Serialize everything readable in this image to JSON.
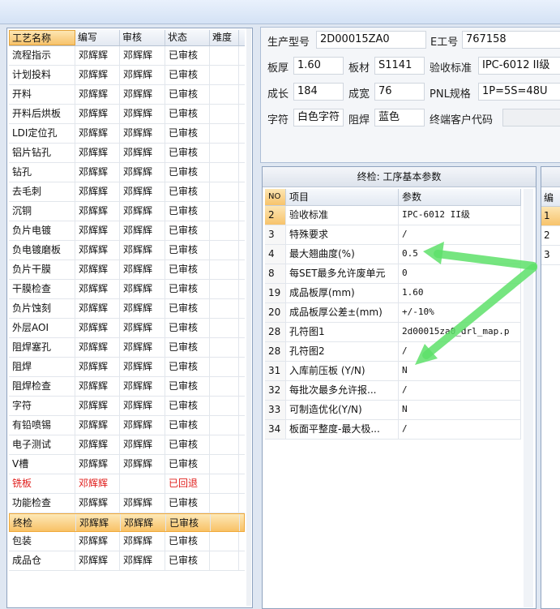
{
  "process_table": {
    "headers": [
      "工艺名称",
      "编写",
      "审核",
      "状态",
      "难度"
    ],
    "rows": [
      {
        "name": "流程指示",
        "writer": "邓辉辉",
        "reviewer": "邓辉辉",
        "status": "已审核",
        "difficulty": ""
      },
      {
        "name": "计划投料",
        "writer": "邓辉辉",
        "reviewer": "邓辉辉",
        "status": "已审核",
        "difficulty": ""
      },
      {
        "name": "开料",
        "writer": "邓辉辉",
        "reviewer": "邓辉辉",
        "status": "已审核",
        "difficulty": ""
      },
      {
        "name": "开料后烘板",
        "writer": "邓辉辉",
        "reviewer": "邓辉辉",
        "status": "已审核",
        "difficulty": ""
      },
      {
        "name": "LDI定位孔",
        "writer": "邓辉辉",
        "reviewer": "邓辉辉",
        "status": "已审核",
        "difficulty": ""
      },
      {
        "name": "铝片钻孔",
        "writer": "邓辉辉",
        "reviewer": "邓辉辉",
        "status": "已审核",
        "difficulty": ""
      },
      {
        "name": "钻孔",
        "writer": "邓辉辉",
        "reviewer": "邓辉辉",
        "status": "已审核",
        "difficulty": ""
      },
      {
        "name": "去毛刺",
        "writer": "邓辉辉",
        "reviewer": "邓辉辉",
        "status": "已审核",
        "difficulty": ""
      },
      {
        "name": "沉铜",
        "writer": "邓辉辉",
        "reviewer": "邓辉辉",
        "status": "已审核",
        "difficulty": ""
      },
      {
        "name": "负片电镀",
        "writer": "邓辉辉",
        "reviewer": "邓辉辉",
        "status": "已审核",
        "difficulty": ""
      },
      {
        "name": "负电镀磨板",
        "writer": "邓辉辉",
        "reviewer": "邓辉辉",
        "status": "已审核",
        "difficulty": ""
      },
      {
        "name": "负片干膜",
        "writer": "邓辉辉",
        "reviewer": "邓辉辉",
        "status": "已审核",
        "difficulty": ""
      },
      {
        "name": "干膜检查",
        "writer": "邓辉辉",
        "reviewer": "邓辉辉",
        "status": "已审核",
        "difficulty": ""
      },
      {
        "name": "负片蚀刻",
        "writer": "邓辉辉",
        "reviewer": "邓辉辉",
        "status": "已审核",
        "difficulty": ""
      },
      {
        "name": "外层AOI",
        "writer": "邓辉辉",
        "reviewer": "邓辉辉",
        "status": "已审核",
        "difficulty": ""
      },
      {
        "name": "阻焊塞孔",
        "writer": "邓辉辉",
        "reviewer": "邓辉辉",
        "status": "已审核",
        "difficulty": ""
      },
      {
        "name": "阻焊",
        "writer": "邓辉辉",
        "reviewer": "邓辉辉",
        "status": "已审核",
        "difficulty": ""
      },
      {
        "name": "阻焊检查",
        "writer": "邓辉辉",
        "reviewer": "邓辉辉",
        "status": "已审核",
        "difficulty": ""
      },
      {
        "name": "字符",
        "writer": "邓辉辉",
        "reviewer": "邓辉辉",
        "status": "已审核",
        "difficulty": ""
      },
      {
        "name": "有铅喷锡",
        "writer": "邓辉辉",
        "reviewer": "邓辉辉",
        "status": "已审核",
        "difficulty": ""
      },
      {
        "name": "电子测试",
        "writer": "邓辉辉",
        "reviewer": "邓辉辉",
        "status": "已审核",
        "difficulty": ""
      },
      {
        "name": "V槽",
        "writer": "邓辉辉",
        "reviewer": "邓辉辉",
        "status": "已审核",
        "difficulty": ""
      },
      {
        "name": "铣板",
        "writer": "邓辉辉",
        "reviewer": "",
        "status": "已回退",
        "difficulty": "",
        "red": true
      },
      {
        "name": "功能检查",
        "writer": "邓辉辉",
        "reviewer": "邓辉辉",
        "status": "已审核",
        "difficulty": ""
      },
      {
        "name": "终检",
        "writer": "邓辉辉",
        "reviewer": "邓辉辉",
        "status": "已审核",
        "difficulty": "",
        "selected": true
      },
      {
        "name": "包装",
        "writer": "邓辉辉",
        "reviewer": "邓辉辉",
        "status": "已审核",
        "difficulty": ""
      },
      {
        "name": "成品仓",
        "writer": "邓辉辉",
        "reviewer": "邓辉辉",
        "status": "已审核",
        "difficulty": ""
      }
    ]
  },
  "info": {
    "model_label": "生产型号",
    "model_value": "2D00015ZA0",
    "ework_label": "E工号",
    "ework_value": "767158",
    "thickness_label": "板厚",
    "thickness_value": "1.60",
    "material_label": "板材",
    "material_value": "S1141",
    "standard_label": "验收标准",
    "standard_value": "IPC-6012 II级",
    "length_label": "成长",
    "length_value": "184",
    "width_label": "成宽",
    "width_value": "76",
    "pnl_label": "PNL规格",
    "pnl_value": "1P=5S=48U",
    "char_label": "字符",
    "char_value": "白色字符",
    "mask_label": "阻焊",
    "mask_value": "蓝色",
    "customer_label": "终端客户代码",
    "customer_value": ""
  },
  "params": {
    "title": "终检: 工序基本参数",
    "headers": [
      "NO",
      "项目",
      "参数"
    ],
    "rows": [
      {
        "no": "2",
        "item": "验收标准",
        "value": "IPC-6012 II级"
      },
      {
        "no": "3",
        "item": "特殊要求",
        "value": "/"
      },
      {
        "no": "4",
        "item": "最大翘曲度(%)",
        "value": "0.5"
      },
      {
        "no": "8",
        "item": "每SET最多允许废单元",
        "value": "0"
      },
      {
        "no": "19",
        "item": "成品板厚(mm)",
        "value": "1.60"
      },
      {
        "no": "20",
        "item": "成品板厚公差±(mm)",
        "value": "+/-10%"
      },
      {
        "no": "28",
        "item": "孔符图1",
        "value": "2d00015za0_drl_map.p"
      },
      {
        "no": "28",
        "item": "孔符图2",
        "value": "/"
      },
      {
        "no": "31",
        "item": "入库前压板 (Y/N)",
        "value": "N"
      },
      {
        "no": "32",
        "item": "每批次最多允许报...",
        "value": "/"
      },
      {
        "no": "33",
        "item": "可制造优化(Y/N)",
        "value": "N"
      },
      {
        "no": "34",
        "item": "板面平整度-最大极...",
        "value": "/"
      }
    ]
  },
  "side_panel": {
    "header": "编",
    "rows": [
      "1",
      "2",
      "3"
    ]
  },
  "annotation": {
    "color": "#5ee06a"
  }
}
